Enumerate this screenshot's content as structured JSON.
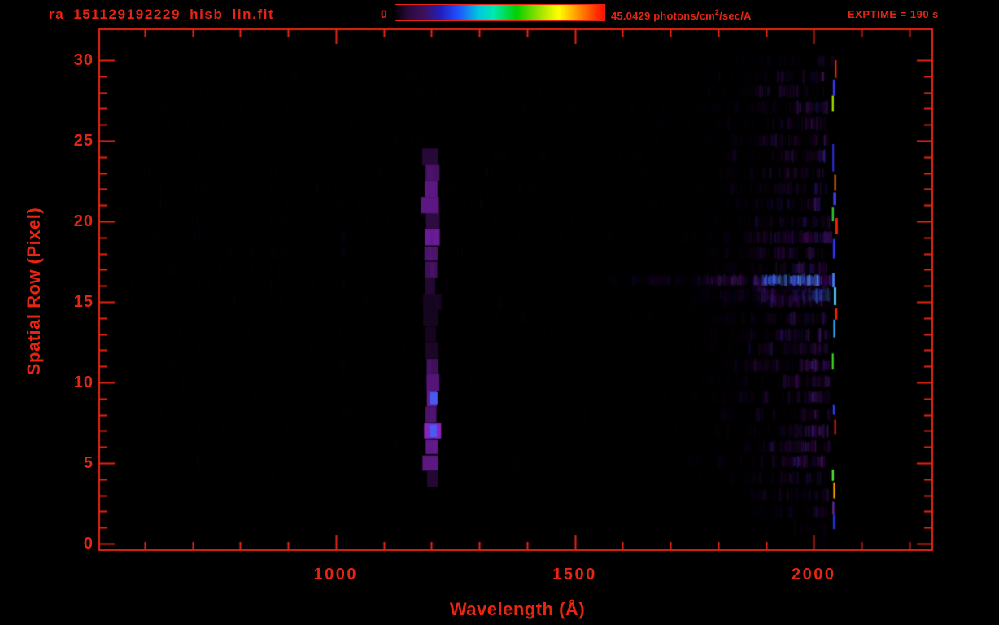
{
  "window_title": "ra_151129192229_hisb_lin.fit",
  "header": {
    "exptime_label": "EXPTIME = 190 s",
    "colorbar": {
      "min_label": "0",
      "max_value": "45.0429",
      "units_prefix": " photons/cm",
      "units_exponent": "2",
      "units_suffix": "/sec/A",
      "gradient_stops": [
        {
          "pos": 0.0,
          "color": "#050008"
        },
        {
          "pos": 0.06,
          "color": "#2a0a3a"
        },
        {
          "pos": 0.14,
          "color": "#3c1060"
        },
        {
          "pos": 0.22,
          "color": "#2020c0"
        },
        {
          "pos": 0.3,
          "color": "#2050ff"
        },
        {
          "pos": 0.4,
          "color": "#00c8e0"
        },
        {
          "pos": 0.47,
          "color": "#00e8b0"
        },
        {
          "pos": 0.58,
          "color": "#00d000"
        },
        {
          "pos": 0.68,
          "color": "#90e000"
        },
        {
          "pos": 0.78,
          "color": "#ffff00"
        },
        {
          "pos": 0.89,
          "color": "#ff8000"
        },
        {
          "pos": 1.0,
          "color": "#ff0800"
        }
      ]
    }
  },
  "chart_data": {
    "type": "heatmap",
    "title": "ra_151129192229_hisb_lin.fit",
    "xlabel": "Wavelength (Å)",
    "ylabel": "Spatial Row (Pixel)",
    "x_range_angstrom": [
      505,
      2248
    ],
    "y_range_rows": [
      0,
      30
    ],
    "x_major_ticks": [
      1000,
      1500,
      2000
    ],
    "x_minor_tick_step": 100,
    "x_minor_tick_start": 600,
    "x_minor_tick_end": 2200,
    "y_major_ticks": [
      0,
      5,
      10,
      15,
      20,
      25,
      30
    ],
    "y_minor_tick_step": 1,
    "value_range": {
      "min": 0,
      "max": 45.0429,
      "units": "photons/cm²/sec/A"
    },
    "exposure_time_s": 190,
    "axis_color": "#e82512",
    "background_color": "#000000",
    "image_features": {
      "palette": {
        "purples": [
          "#1c0026",
          "#30003f",
          "#3c0152",
          "#4b0168",
          "#5a1a86",
          "#6a2a9a"
        ],
        "blue": "#2a2ad0",
        "bright_blue": "#4466ff",
        "light_blue": "#66aaff",
        "cyan": "#55ccff"
      },
      "data_wavelength_end": 2048,
      "noise_background": {
        "wl": [
          600,
          1760
        ],
        "rows": [
          1,
          29.5
        ],
        "alpha": 0.1
      },
      "noise_mid_band": {
        "wl": [
          560,
          1360
        ],
        "rows": [
          15,
          23.5
        ],
        "alpha": 0.15
      },
      "noise_dense": {
        "wl": [
          1715,
          2040
        ],
        "alpha_start": 0.07,
        "alpha_end": 0.65,
        "blue_fraction": 0.05
      },
      "row_gain": {
        "0": 0.15,
        "1": 0.3,
        "2": 0.45,
        "3": 0.6,
        "4": 0.75,
        "29": 0.85,
        "30": 0.55
      },
      "faint_columns": [
        {
          "wl": 709,
          "rows": [
            3,
            24
          ],
          "alpha": 0.07
        },
        {
          "wl": 860,
          "rows": [
            14,
            23
          ],
          "alpha": 0.08
        },
        {
          "wl": 1012,
          "rows": [
            14,
            20
          ],
          "alpha": 0.1
        },
        {
          "wl": 1210,
          "rows": [
            12,
            17
          ],
          "alpha": 0.12
        }
      ],
      "emission_line": {
        "name": "Lyman-alpha",
        "wavelength_center": 1200,
        "wavelength_width": 36,
        "row_profile": [
          {
            "row": 24,
            "i": 0.3
          },
          {
            "row": 23,
            "i": 0.55
          },
          {
            "row": 22,
            "i": 0.7
          },
          {
            "row": 21,
            "i": 0.7
          },
          {
            "row": 20,
            "i": 0.35
          },
          {
            "row": 19,
            "i": 0.8
          },
          {
            "row": 18,
            "i": 0.6
          },
          {
            "row": 17,
            "i": 0.5
          },
          {
            "row": 16,
            "i": 0.25
          },
          {
            "row": 15,
            "i": 0.12
          },
          {
            "row": 14,
            "i": 0.1
          },
          {
            "row": 13,
            "i": 0.1
          },
          {
            "row": 12,
            "i": 0.18
          },
          {
            "row": 11,
            "i": 0.5
          },
          {
            "row": 10,
            "i": 0.65
          },
          {
            "row": 9,
            "i": 0.8,
            "blue": true
          },
          {
            "row": 8,
            "i": 0.6
          },
          {
            "row": 7,
            "i": 0.95,
            "blue": true
          },
          {
            "row": 6,
            "i": 0.75
          },
          {
            "row": 5,
            "i": 0.7
          },
          {
            "row": 4,
            "i": 0.25
          }
        ]
      },
      "bright_row_streaks": [
        {
          "row": 16.35,
          "height": 12,
          "wl": [
            1557,
            2040
          ],
          "i": [
            0.12,
            0.9
          ],
          "blue_wl": [
            1890,
            2010
          ]
        },
        {
          "row": 15.4,
          "height": 15,
          "wl": [
            1690,
            2040
          ],
          "i": [
            0.07,
            0.5
          ],
          "blue_wl": [
            1985,
            2035
          ]
        }
      ],
      "edge_pixels": [
        {
          "rows": [
            28.9,
            30.0
          ],
          "color": "#ff2200",
          "wl": 2044
        },
        {
          "rows": [
            27.8,
            28.8
          ],
          "color": "#3a3aff",
          "wl": 2040
        },
        {
          "rows": [
            26.8,
            27.8
          ],
          "color": "#aaee00",
          "wl": 2038
        },
        {
          "rows": [
            23.1,
            24.8
          ],
          "color": "#3030f0",
          "wl": 2039
        },
        {
          "rows": [
            21.9,
            22.9
          ],
          "color": "#ff7700",
          "wl": 2043
        },
        {
          "rows": [
            21.0,
            21.8
          ],
          "color": "#4444ff",
          "wl": 2041
        },
        {
          "rows": [
            20.0,
            20.9
          ],
          "color": "#33cc33",
          "wl": 2038
        },
        {
          "rows": [
            19.2,
            20.2
          ],
          "color": "#ff2200",
          "wl": 2045
        },
        {
          "rows": [
            17.7,
            18.9
          ],
          "color": "#3333ff",
          "wl": 2040
        },
        {
          "rows": [
            15.9,
            16.8
          ],
          "color": "#4488ff",
          "wl": 2039
        },
        {
          "rows": [
            14.8,
            15.9
          ],
          "color": "#55ccff",
          "wl": 2042
        },
        {
          "rows": [
            13.9,
            14.6
          ],
          "color": "#ff2200",
          "wl": 2044
        },
        {
          "rows": [
            12.8,
            13.9
          ],
          "color": "#33aaff",
          "wl": 2041
        },
        {
          "rows": [
            10.8,
            11.8
          ],
          "color": "#44ee22",
          "wl": 2038
        },
        {
          "rows": [
            8.0,
            8.6
          ],
          "color": "#3344ff",
          "wl": 2040
        },
        {
          "rows": [
            6.8,
            7.7
          ],
          "color": "#ff2200",
          "wl": 2043
        },
        {
          "rows": [
            3.9,
            4.6
          ],
          "color": "#55ee33",
          "wl": 2038
        },
        {
          "rows": [
            2.8,
            3.8
          ],
          "color": "#ffaa00",
          "wl": 2041
        },
        {
          "rows": [
            1.8,
            2.6
          ],
          "color": "#6a2a9a",
          "wl": 2039
        },
        {
          "rows": [
            0.9,
            1.8
          ],
          "color": "#2233cc",
          "wl": 2040
        }
      ]
    }
  }
}
